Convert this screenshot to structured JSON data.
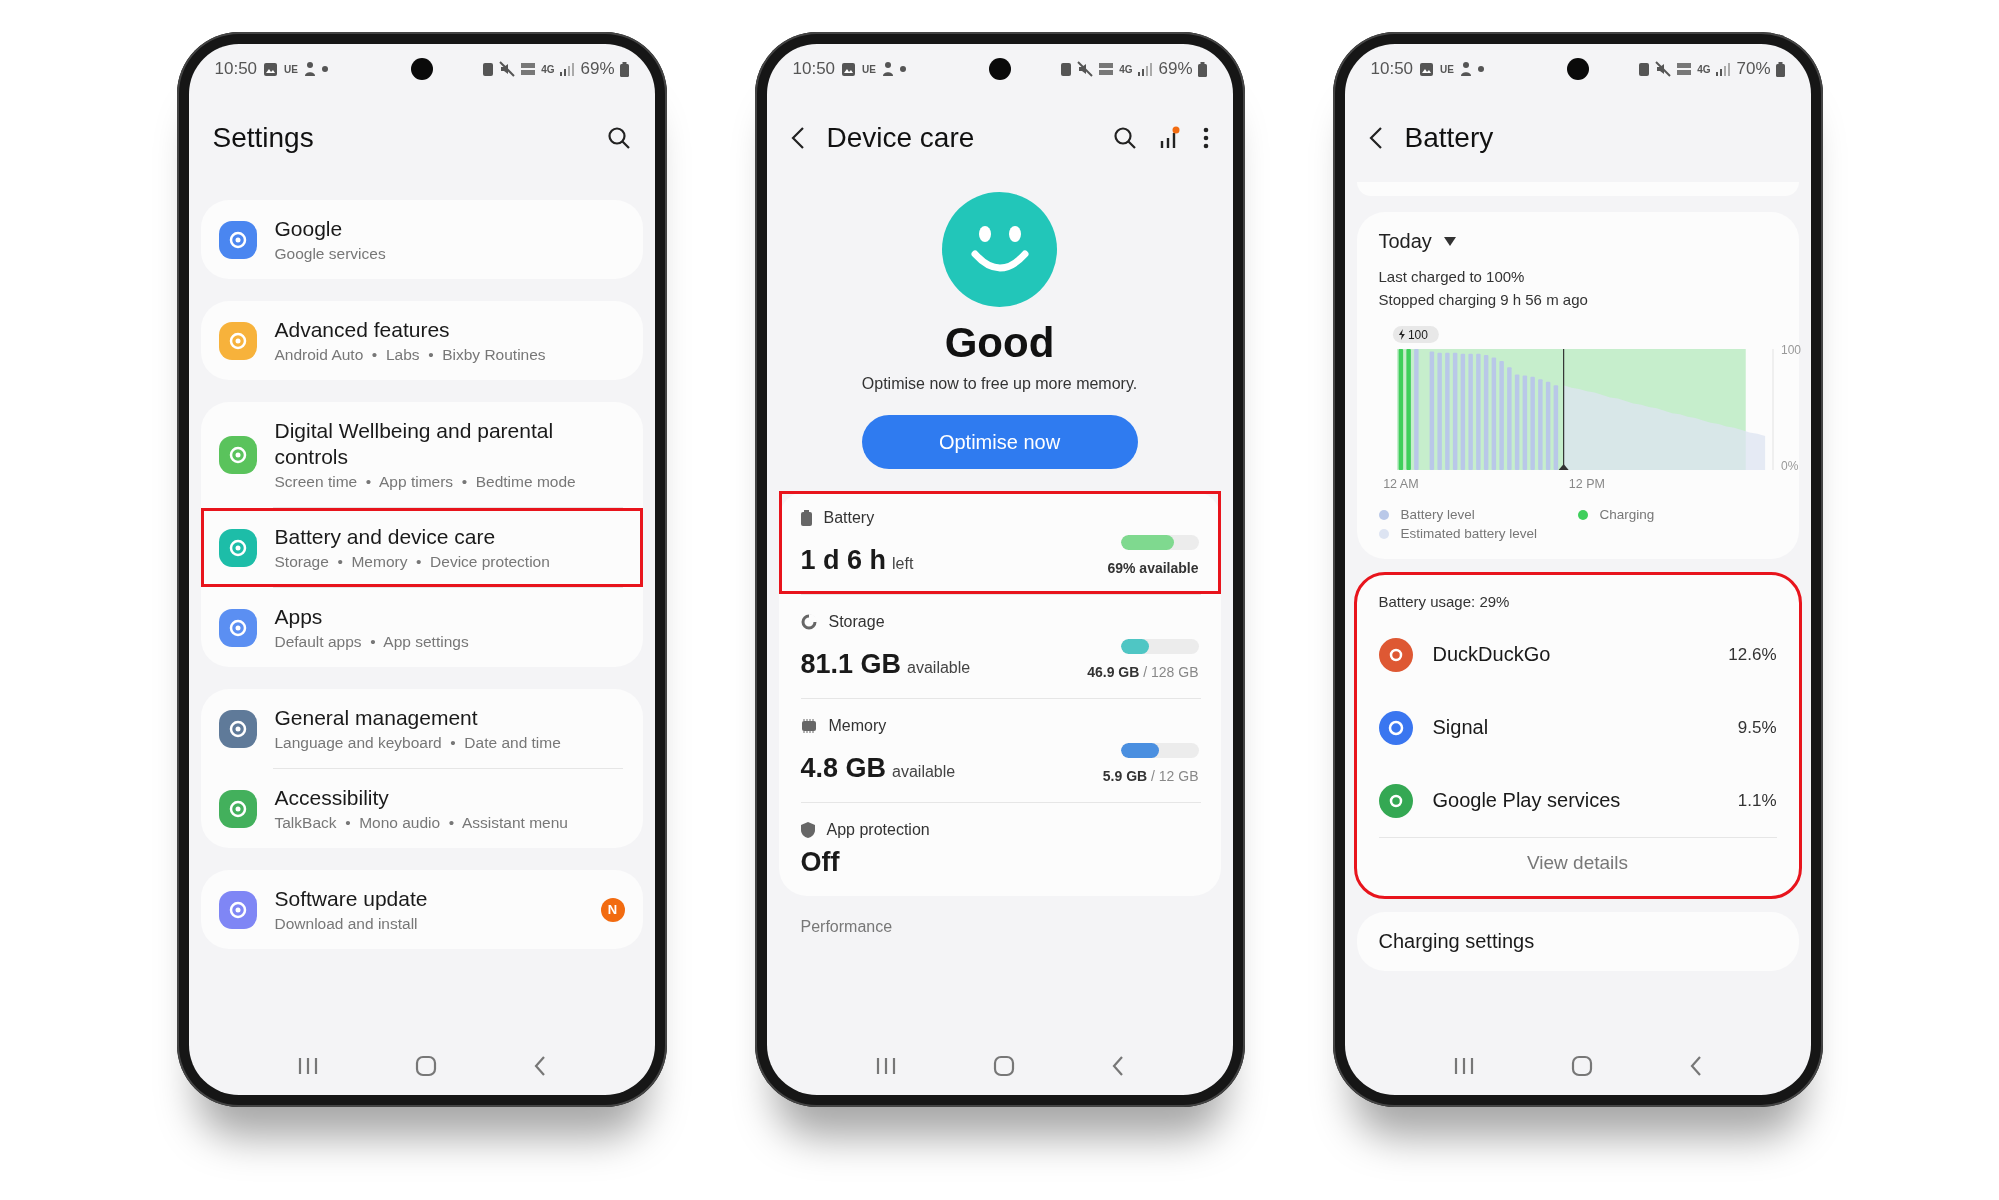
{
  "phones": [
    {
      "kind": "settings",
      "status_bar": {
        "time": "10:50",
        "tag": "UE",
        "network": "4G",
        "battery": "69%"
      },
      "title": "Settings",
      "groups": [
        {
          "items": [
            {
              "title": "Google",
              "subtitle": "Google services",
              "color": "#4a86f0",
              "highlighted": false
            }
          ]
        },
        {
          "items": [
            {
              "title": "Advanced features",
              "subtitle": "Android Auto  •  Labs  •  Bixby Routines",
              "color": "#f7b23b",
              "highlighted": false
            }
          ]
        },
        {
          "items": [
            {
              "title": "Digital Wellbeing and parental controls",
              "subtitle": "Screen time  •  App timers  •  Bedtime mode",
              "color": "#5ac35c",
              "highlighted": false
            },
            {
              "title": "Battery and device care",
              "subtitle": "Storage  •  Memory  •  Device protection",
              "color": "#1dbda8",
              "highlighted": true
            },
            {
              "title": "Apps",
              "subtitle": "Default apps  •  App settings",
              "color": "#5b8ff2",
              "highlighted": false
            }
          ]
        },
        {
          "items": [
            {
              "title": "General management",
              "subtitle": "Language and keyboard  •  Date and time",
              "color": "#5f7a99",
              "highlighted": false
            },
            {
              "title": "Accessibility",
              "subtitle": "TalkBack  •  Mono audio  •  Assistant menu",
              "color": "#43b05c",
              "highlighted": false
            }
          ]
        },
        {
          "items": [
            {
              "title": "Software update",
              "subtitle": "Download and install",
              "color": "#7f86f5",
              "highlighted": false,
              "badge": "N"
            }
          ]
        }
      ]
    },
    {
      "kind": "device_care",
      "status_bar": {
        "time": "10:50",
        "tag": "UE",
        "network": "4G",
        "battery": "69%"
      },
      "title": "Device care",
      "status": "Good",
      "message": "Optimise now to free up more memory.",
      "action": "Optimise now",
      "metrics": [
        {
          "kind": "battery",
          "label": "Battery",
          "value": "1 d 6 h",
          "unit": "left",
          "level": 0.69,
          "reading": "69% available",
          "color": "#7fd98f",
          "highlighted": true
        },
        {
          "kind": "storage",
          "label": "Storage",
          "value": "81.1 GB",
          "unit": "available",
          "level": 0.37,
          "reading": "**46.9 GB** / 128 GB",
          "color": "#4fc6c4",
          "highlighted": false
        },
        {
          "kind": "memory",
          "label": "Memory",
          "value": "4.8 GB",
          "unit": "available",
          "level": 0.49,
          "reading": "**5.9 GB** / 12 GB",
          "color": "#4a8fe0",
          "highlighted": false
        },
        {
          "kind": "protection",
          "label": "App protection",
          "value": "Off",
          "highlighted": false
        }
      ],
      "section": "Performance"
    },
    {
      "kind": "battery",
      "status_bar": {
        "time": "10:50",
        "tag": "UE",
        "network": "4G",
        "battery": "70%"
      },
      "title": "Battery",
      "period": "Today",
      "info": [
        "Last charged to 100%",
        "Stopped charging 9 h 56 m ago"
      ],
      "chart": {
        "chart_data": {
          "type": "bar",
          "categories": [
            "12 AM",
            null,
            null,
            null,
            null,
            null,
            null,
            null,
            null,
            null,
            null,
            null,
            null,
            null,
            null,
            null,
            null,
            null,
            null,
            null,
            null,
            null,
            null,
            null,
            "12 PM",
            null,
            null,
            null,
            null,
            null,
            null,
            null,
            null,
            null,
            null,
            null,
            null,
            null,
            null,
            null,
            null,
            null,
            null,
            null,
            null,
            null,
            null,
            null
          ],
          "ylim": [
            0,
            100
          ],
          "yticks": [
            {
              "value": 100,
              "label": "100"
            },
            {
              "value": 0,
              "label": "0%"
            }
          ],
          "series": [
            {
              "name": "Battery level",
              "color": "#b9c8e8",
              "values": [
                null,
                null,
                100,
                null,
                98,
                97,
                97,
                97,
                96,
                96,
                96,
                95,
                93,
                90,
                85,
                79,
                78,
                77,
                75,
                73,
                70,
                null,
                null,
                null,
                null,
                null,
                null,
                null,
                null,
                null,
                null,
                null,
                null,
                null,
                null,
                null,
                null,
                null,
                null,
                null,
                null,
                null,
                null,
                null,
                null,
                null,
                null,
                null
              ]
            },
            {
              "name": "Charging",
              "color": "#3fcf5c",
              "values": [
                100,
                100,
                null,
                null,
                null,
                null,
                null,
                null,
                null,
                null,
                null,
                null,
                null,
                null,
                null,
                null,
                null,
                null,
                null,
                null,
                null,
                null,
                null,
                null,
                null,
                null,
                null,
                null,
                null,
                null,
                null,
                null,
                null,
                null,
                null,
                null,
                null,
                null,
                null,
                null,
                null,
                null,
                null,
                null,
                null,
                null,
                null,
                null
              ]
            },
            {
              "name": "Estimated battery level",
              "type": "area",
              "color": "#dde4f2",
              "values": [
                null,
                null,
                null,
                null,
                null,
                null,
                null,
                null,
                null,
                null,
                null,
                null,
                null,
                null,
                null,
                null,
                null,
                null,
                null,
                null,
                null,
                70,
                68,
                67,
                65,
                64,
                62,
                60,
                59,
                57,
                55,
                54,
                52,
                51,
                49,
                47,
                46,
                44,
                43,
                41,
                39,
                38,
                36,
                35,
                33,
                31,
                30,
                28
              ]
            }
          ],
          "annotations": [
            "100"
          ]
        }
      },
      "usage": {
        "title": "Battery usage: 29%",
        "highlighted": true,
        "apps": [
          {
            "name": "DuckDuckGo",
            "percent": "12.6%",
            "color": "#de5833"
          },
          {
            "name": "Signal",
            "percent": "9.5%",
            "color": "#3a76f0"
          },
          {
            "name": "Google Play services",
            "percent": "1.1%",
            "color": "#34a853"
          }
        ],
        "action": "View details"
      },
      "section": "Charging settings"
    }
  ]
}
